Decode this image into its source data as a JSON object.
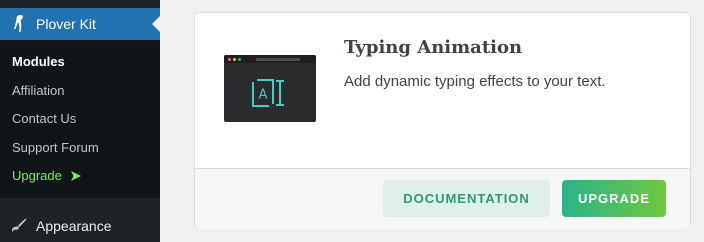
{
  "sidebar": {
    "active_menu": {
      "label": "Plover Kit",
      "icon": "bird-icon"
    },
    "submenu": [
      {
        "label": "Modules",
        "current": true
      },
      {
        "label": "Affiliation"
      },
      {
        "label": "Contact Us"
      },
      {
        "label": "Support Forum"
      },
      {
        "label": "Upgrade",
        "icon": "arrow-right-icon"
      }
    ],
    "appearance": {
      "label": "Appearance",
      "icon": "brush-icon"
    }
  },
  "module_card": {
    "title": "Typing Animation",
    "description": "Add dynamic typing effects to your text.",
    "thumbnail_glyph": "A",
    "documentation_button": "Documentation",
    "upgrade_button": "Upgrade"
  },
  "colors": {
    "sidebar_bg": "#1d2327",
    "active_menu_bg": "#2271b1",
    "upgrade_link": "#79ef4e",
    "doc_button_bg": "#dff0ea",
    "doc_button_text": "#2a9c72",
    "upgrade_gradient_start": "#2bb38a",
    "upgrade_gradient_end": "#6fc83f"
  }
}
